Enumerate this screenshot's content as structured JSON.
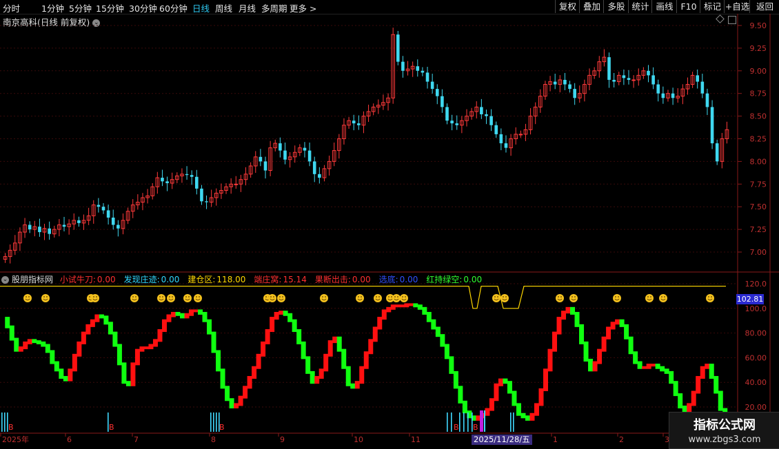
{
  "toolbar": {
    "periods": [
      "分时",
      "1分钟",
      "5分钟",
      "15分钟",
      "30分钟",
      "60分钟",
      "日线",
      "周线",
      "月线",
      "多周期",
      "更多 >"
    ],
    "active_period": "日线",
    "right_buttons": [
      "复权",
      "叠加",
      "多股",
      "统计",
      "画线",
      "F10",
      "标记",
      "+自选",
      "返回"
    ]
  },
  "chart_title": "南京高科(日线 前复权)",
  "price_axis": [
    "9.50",
    "9.25",
    "9.00",
    "8.75",
    "8.50",
    "8.25",
    "8.00",
    "7.75",
    "7.50",
    "7.25",
    "7.00"
  ],
  "indicator": {
    "name": "股朋指标网",
    "items": [
      {
        "label": "小试牛刀:",
        "value": "0.00",
        "color": "#ff3030"
      },
      {
        "label": "发现庄迹:",
        "value": "0.00",
        "color": "#30d8ff"
      },
      {
        "label": "建仓区:",
        "value": "118.00",
        "color": "#ffd700"
      },
      {
        "label": "端庄窝:",
        "value": "15.14",
        "color": "#ff3030"
      },
      {
        "label": "果断出击:",
        "value": "0.00",
        "color": "#ff3030"
      },
      {
        "label": "选底:",
        "value": "0.00",
        "color": "#3050ff"
      },
      {
        "label": "红持绿空:",
        "value": "0.00",
        "color": "#30ff30"
      }
    ],
    "axis": [
      "120.0",
      "100.0",
      "80.00",
      "60.00",
      "40.00",
      "20.00"
    ],
    "current_value": "102.81"
  },
  "date_axis": [
    "2025年",
    "6",
    "7",
    "8",
    "9",
    "10",
    "11",
    "2025/11/28/五",
    "1",
    "2",
    "3"
  ],
  "watermark": {
    "line1": "指标公式网",
    "line2": "www.zbgs3.com"
  },
  "colors": {
    "up": "#ff3a3a",
    "down": "#3fd8f0",
    "osc_up": "#ff1010",
    "osc_down": "#10ff10",
    "line": "#ffd700"
  },
  "chart_data": {
    "type": "candlestick",
    "price_ylim": [
      6.9,
      9.55
    ],
    "closes": [
      6.95,
      7.02,
      7.1,
      7.22,
      7.3,
      7.25,
      7.28,
      7.22,
      7.26,
      7.2,
      7.25,
      7.3,
      7.28,
      7.31,
      7.35,
      7.32,
      7.35,
      7.4,
      7.52,
      7.5,
      7.46,
      7.38,
      7.3,
      7.26,
      7.35,
      7.45,
      7.52,
      7.55,
      7.6,
      7.62,
      7.72,
      7.82,
      7.78,
      7.76,
      7.8,
      7.84,
      7.86,
      7.85,
      7.83,
      7.7,
      7.56,
      7.55,
      7.6,
      7.65,
      7.68,
      7.72,
      7.75,
      7.75,
      7.8,
      7.86,
      7.95,
      8.05,
      8.0,
      7.9,
      8.15,
      8.2,
      8.12,
      8.02,
      8.05,
      8.1,
      8.15,
      8.12,
      8.0,
      7.86,
      7.82,
      7.92,
      8.0,
      8.12,
      8.25,
      8.4,
      8.45,
      8.42,
      8.4,
      8.5,
      8.55,
      8.6,
      8.62,
      8.65,
      8.7,
      9.4,
      9.1,
      9.0,
      9.02,
      9.05,
      9.0,
      8.98,
      8.88,
      8.8,
      8.72,
      8.6,
      8.45,
      8.42,
      8.4,
      8.45,
      8.5,
      8.55,
      8.6,
      8.52,
      8.5,
      8.4,
      8.3,
      8.2,
      8.15,
      8.25,
      8.3,
      8.3,
      8.35,
      8.5,
      8.6,
      8.72,
      8.85,
      8.88,
      8.85,
      8.9,
      8.85,
      8.8,
      8.7,
      8.75,
      8.85,
      8.95,
      9.0,
      9.1,
      9.15,
      8.9,
      8.88,
      8.95,
      8.92,
      8.9,
      8.9,
      8.95,
      9.0,
      8.95,
      8.85,
      8.75,
      8.7,
      8.75,
      8.7,
      8.72,
      8.8,
      8.85,
      8.95,
      8.88,
      8.75,
      8.6,
      8.2,
      8.0,
      8.25,
      8.35
    ],
    "oscillator_ylim": [
      10,
      125
    ],
    "osc": [
      92,
      85,
      75,
      66,
      68,
      72,
      74,
      73,
      72,
      70,
      65,
      56,
      50,
      44,
      42,
      50,
      62,
      72,
      80,
      86,
      90,
      94,
      93,
      88,
      80,
      70,
      55,
      40,
      38,
      55,
      66,
      68,
      68,
      70,
      74,
      82,
      90,
      94,
      96,
      95,
      93,
      95,
      98,
      98,
      96,
      90,
      80,
      65,
      50,
      36,
      26,
      20,
      22,
      28,
      36,
      44,
      52,
      62,
      72,
      82,
      92,
      96,
      97,
      95,
      90,
      82,
      72,
      60,
      48,
      40,
      44,
      50,
      62,
      73,
      76,
      66,
      52,
      38,
      36,
      40,
      52,
      64,
      74,
      84,
      92,
      98,
      100,
      102,
      102,
      102,
      103,
      103,
      102,
      100,
      96,
      90,
      84,
      78,
      70,
      60,
      48,
      36,
      24,
      16,
      12,
      10,
      12,
      14,
      18,
      26,
      38,
      42,
      40,
      32,
      22,
      14,
      12,
      10,
      14,
      22,
      34,
      50,
      66,
      80,
      92,
      97,
      100,
      96,
      86,
      72,
      58,
      50,
      56,
      66,
      76,
      84,
      88,
      90,
      86,
      76,
      64,
      56,
      52,
      52,
      54,
      54,
      52,
      50,
      48,
      40,
      30,
      20,
      16,
      22,
      32,
      44,
      52,
      54,
      44,
      32,
      18,
      14
    ]
  }
}
